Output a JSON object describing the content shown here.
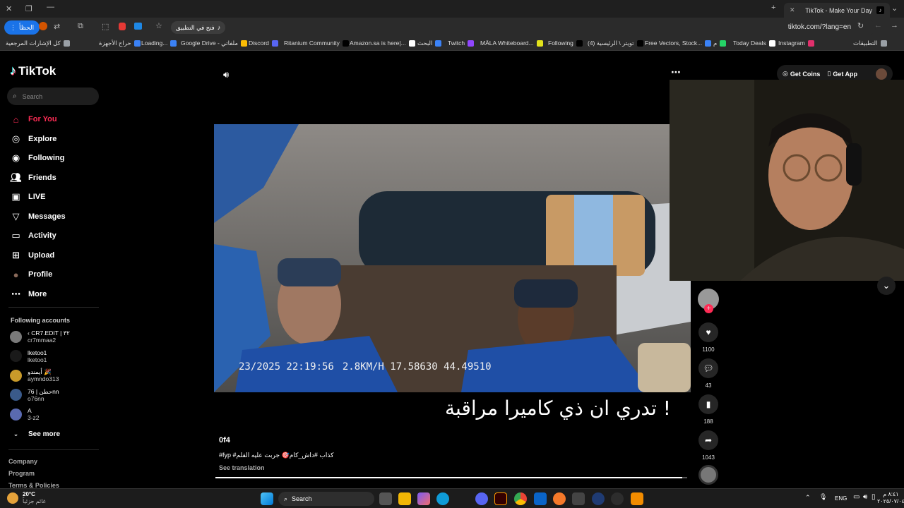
{
  "browser": {
    "active_tab_title": "TikTok - Make Your Day",
    "url": "tiktok.com/?lang=en",
    "open_in_app_label": "فتح في التطبيق",
    "profile_label": "الحظأ",
    "bookmarks": [
      {
        "label": "كل الإشارات المرجعية",
        "color": "#9aa0a6"
      },
      {
        "label": "حراج الأجهزة",
        "color": "#3b82f6"
      },
      {
        "label": "Loading...",
        "color": "#3b82f6"
      },
      {
        "label": "Google Drive - ملفاتي",
        "color": "#fbbc04"
      },
      {
        "label": "Discord",
        "color": "#5865f2"
      },
      {
        "label": "Ritanium Community",
        "color": "#000000"
      },
      {
        "label": "Amazon.sa is here|...",
        "color": "#ffffff"
      },
      {
        "label": "البحث",
        "color": "#3b82f6"
      },
      {
        "label": "Twitch",
        "color": "#9146ff"
      },
      {
        "label": "MÄLA Whiteboard...",
        "color": "#e2e21b"
      },
      {
        "label": "Following",
        "color": "#000000"
      },
      {
        "label": "(4) تويتر \\ الرئيسية",
        "color": "#000000"
      },
      {
        "label": "Free Vectors, Stock...",
        "color": "#3b82f6"
      },
      {
        "label": "م",
        "color": "#25d366"
      },
      {
        "label": "Today Deals",
        "color": "#ffffff"
      },
      {
        "label": "Instagram",
        "color": "#e1306c"
      },
      {
        "label": "التطبيقات",
        "color": "#9aa0a6"
      }
    ]
  },
  "sidebar": {
    "logo": "TikTok",
    "search_placeholder": "Search",
    "nav": [
      {
        "label": "For You",
        "icon": "home-icon",
        "active": true
      },
      {
        "label": "Explore",
        "icon": "compass-icon"
      },
      {
        "label": "Following",
        "icon": "following-icon"
      },
      {
        "label": "Friends",
        "icon": "friends-icon"
      },
      {
        "label": "LIVE",
        "icon": "live-icon"
      },
      {
        "label": "Messages",
        "icon": "messages-icon"
      },
      {
        "label": "Activity",
        "icon": "activity-icon"
      },
      {
        "label": "Upload",
        "icon": "upload-icon"
      },
      {
        "label": "Profile",
        "icon": "avatar"
      },
      {
        "label": "More",
        "icon": "more-icon"
      }
    ],
    "following_accounts_title": "Following accounts",
    "accounts": [
      {
        "name": "‹ CR7.EDIT | ٣٢",
        "handle": "cr7mmaa2"
      },
      {
        "name": "lketoo1",
        "handle": "lketoo1"
      },
      {
        "name": "أيمندو 🎉",
        "handle": "aymndo313"
      },
      {
        "name": "76 | حطنnn",
        "handle": "o76nn"
      },
      {
        "name": "A",
        "handle": "3-z2"
      }
    ],
    "see_more": "See more",
    "footer_links": [
      "Company",
      "Program",
      "Terms & Policies"
    ]
  },
  "header": {
    "get_coins": "Get Coins",
    "get_app": "Get App"
  },
  "video": {
    "overlay_timestamp": "23/2025 22:19:56",
    "overlay_speed": "2.8KM/H 17.58630 44.49510",
    "caption_overlay": "تدري ان ذي كاميرا مراقبة !",
    "author": "0f4",
    "description": "#fyp #كذاب #داش_كام🎯 جربت عليه القلم",
    "see_translation": "See translation",
    "likes": "1100",
    "comments": "43",
    "saves": "188",
    "shares": "1043"
  },
  "taskbar": {
    "weather_temp": "20°C",
    "weather_desc": "غائم جزئياً",
    "search_label": "Search",
    "lang": "ENG",
    "time": "٨:٤١ م",
    "date": "٢٠٢٥/٠٧/٠٤"
  }
}
